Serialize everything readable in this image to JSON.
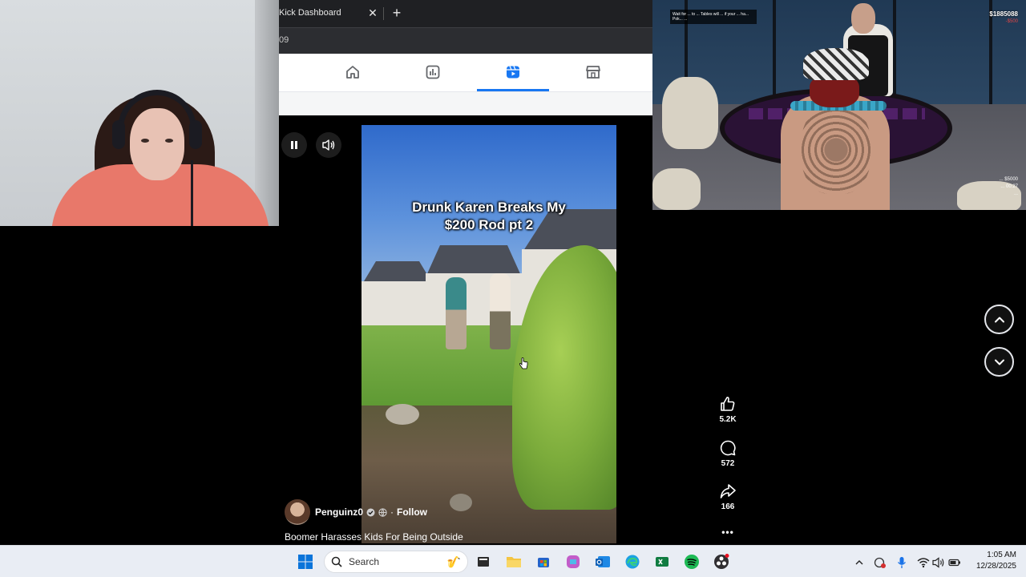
{
  "browser": {
    "tab_title": "Kick Dashboard",
    "tab_close": "✕",
    "new_tab": "+",
    "address_fragment": "09",
    "nav": [
      "home-icon",
      "insights-icon",
      "reels-icon",
      "marketplace-icon"
    ],
    "accent": "#1877f2"
  },
  "game": {
    "hud_message": "Wait for ... to ... Tables will ... if your ... ha... Pok... ...",
    "cash": "$1885088",
    "cash_sub": "-$500",
    "bet_info": [
      "... $5000",
      "... 00:27",
      "..."
    ]
  },
  "reel": {
    "caption_line1": "Drunk Karen Breaks My",
    "caption_line2": "$200 Rod pt 2",
    "likes": "5.2K",
    "comments": "572",
    "shares": "166",
    "more": "•••",
    "author": "Penguinz0",
    "separator": "·",
    "follow": "Follow",
    "description": "Boomer Harasses Kids For Being Outside"
  },
  "taskbar": {
    "search_label": "Search",
    "time": "1:05 AM",
    "date": "12/28/2025"
  }
}
